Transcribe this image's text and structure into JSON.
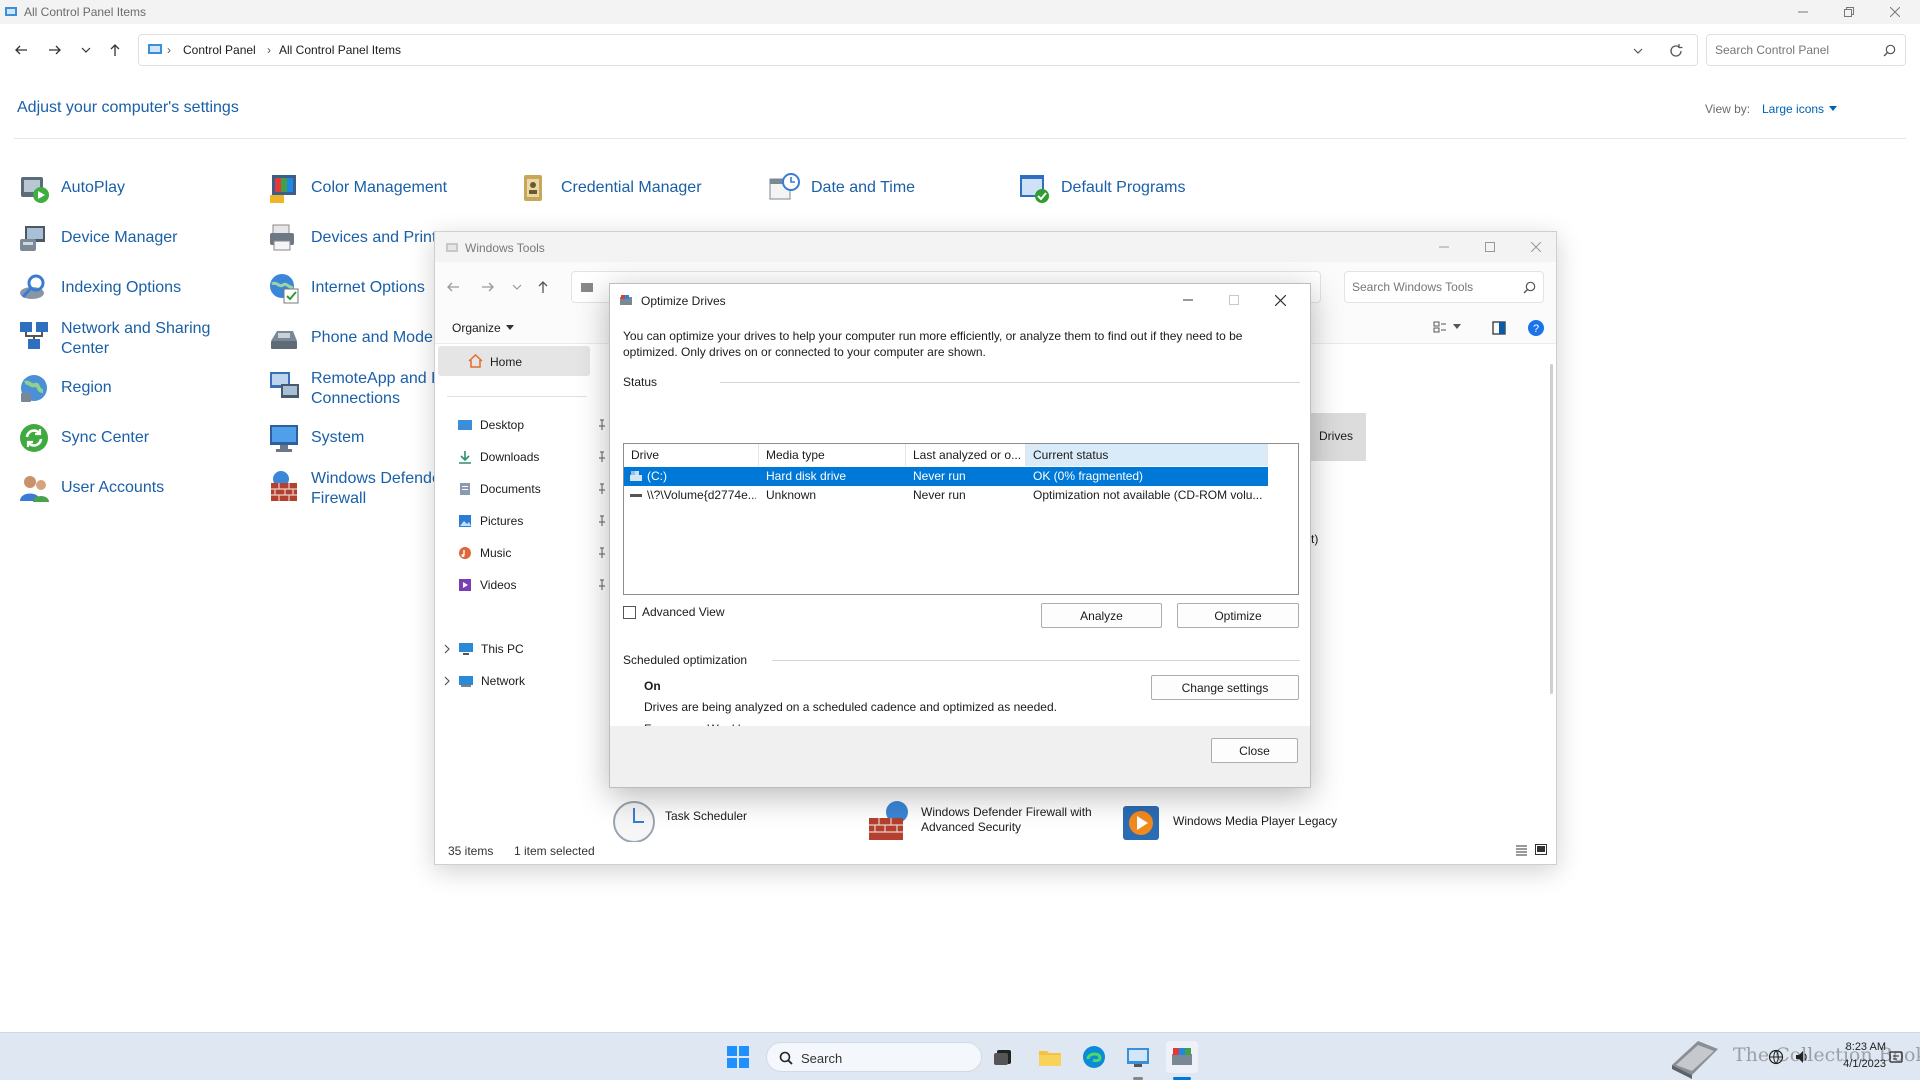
{
  "control_panel": {
    "window_title": "All Control Panel Items",
    "breadcrumb": [
      "Control Panel",
      "All Control Panel Items"
    ],
    "search_placeholder": "Search Control Panel",
    "heading": "Adjust your computer's settings",
    "view_by_label": "View by:",
    "view_by_value": "Large icons",
    "items": [
      {
        "label": "AutoPlay"
      },
      {
        "label": "Color Management"
      },
      {
        "label": "Credential Manager"
      },
      {
        "label": "Date and Time"
      },
      {
        "label": "Default Programs"
      },
      {
        "label": "Device Manager"
      },
      {
        "label": "Devices and Print"
      },
      {
        "label": "Indexing Options"
      },
      {
        "label": "Internet Options"
      },
      {
        "label": "Network and Sharing",
        "label2": "Center"
      },
      {
        "label": "Phone and Moder"
      },
      {
        "label": "Region"
      },
      {
        "label": "RemoteApp and D",
        "label2": "Connections"
      },
      {
        "label": "Sync Center"
      },
      {
        "label": "System"
      },
      {
        "label": "User Accounts"
      },
      {
        "label": "Windows Defende",
        "label2": "Firewall"
      }
    ]
  },
  "windows_tools": {
    "window_title": "Windows Tools",
    "search_placeholder": "Search Windows Tools",
    "organize_label": "Organize",
    "sidebar": {
      "home": "Home",
      "quick": [
        "Desktop",
        "Downloads",
        "Documents",
        "Pictures",
        "Music",
        "Videos"
      ],
      "this_pc": "This PC",
      "network": "Network"
    },
    "content_items": [
      "Task Scheduler",
      "Windows Defender Firewall with",
      "Advanced Security",
      "Windows Media Player Legacy"
    ],
    "selected_fragment": "Drives",
    "fragment_t": "t)",
    "status": {
      "count": "35 items",
      "selected": "1 item selected"
    }
  },
  "optimize_drives": {
    "title": "Optimize Drives",
    "intro_line1": "You can optimize your drives to help your computer run more efficiently, or analyze them to find out if they need to be",
    "intro_line2": "optimized. Only drives on or connected to your computer are shown.",
    "status_heading": "Status",
    "columns": [
      "Drive",
      "Media type",
      "Last analyzed or o...",
      "Current status"
    ],
    "rows": [
      {
        "drive": "(C:)",
        "media": "Hard disk drive",
        "last": "Never run",
        "status": "OK (0% fragmented)",
        "selected": true
      },
      {
        "drive": "\\\\?\\Volume{d2774e...",
        "media": "Unknown",
        "last": "Never run",
        "status": "Optimization not available (CD-ROM volu...",
        "selected": false
      }
    ],
    "advanced_view": "Advanced View",
    "analyze": "Analyze",
    "optimize": "Optimize",
    "scheduled_heading": "Scheduled optimization",
    "scheduled_state": "On",
    "scheduled_desc": "Drives are being analyzed on a scheduled cadence and optimized as needed.",
    "frequency": "Frequency: Weekly",
    "change_settings": "Change settings",
    "close": "Close"
  },
  "taskbar": {
    "search": "Search",
    "time": "8:23 AM",
    "date": "4/1/2023",
    "watermark": "The Collection Book"
  },
  "colors": {
    "accent": "#0078d7",
    "link": "#1a5fa8",
    "selection": "#0078d7"
  }
}
